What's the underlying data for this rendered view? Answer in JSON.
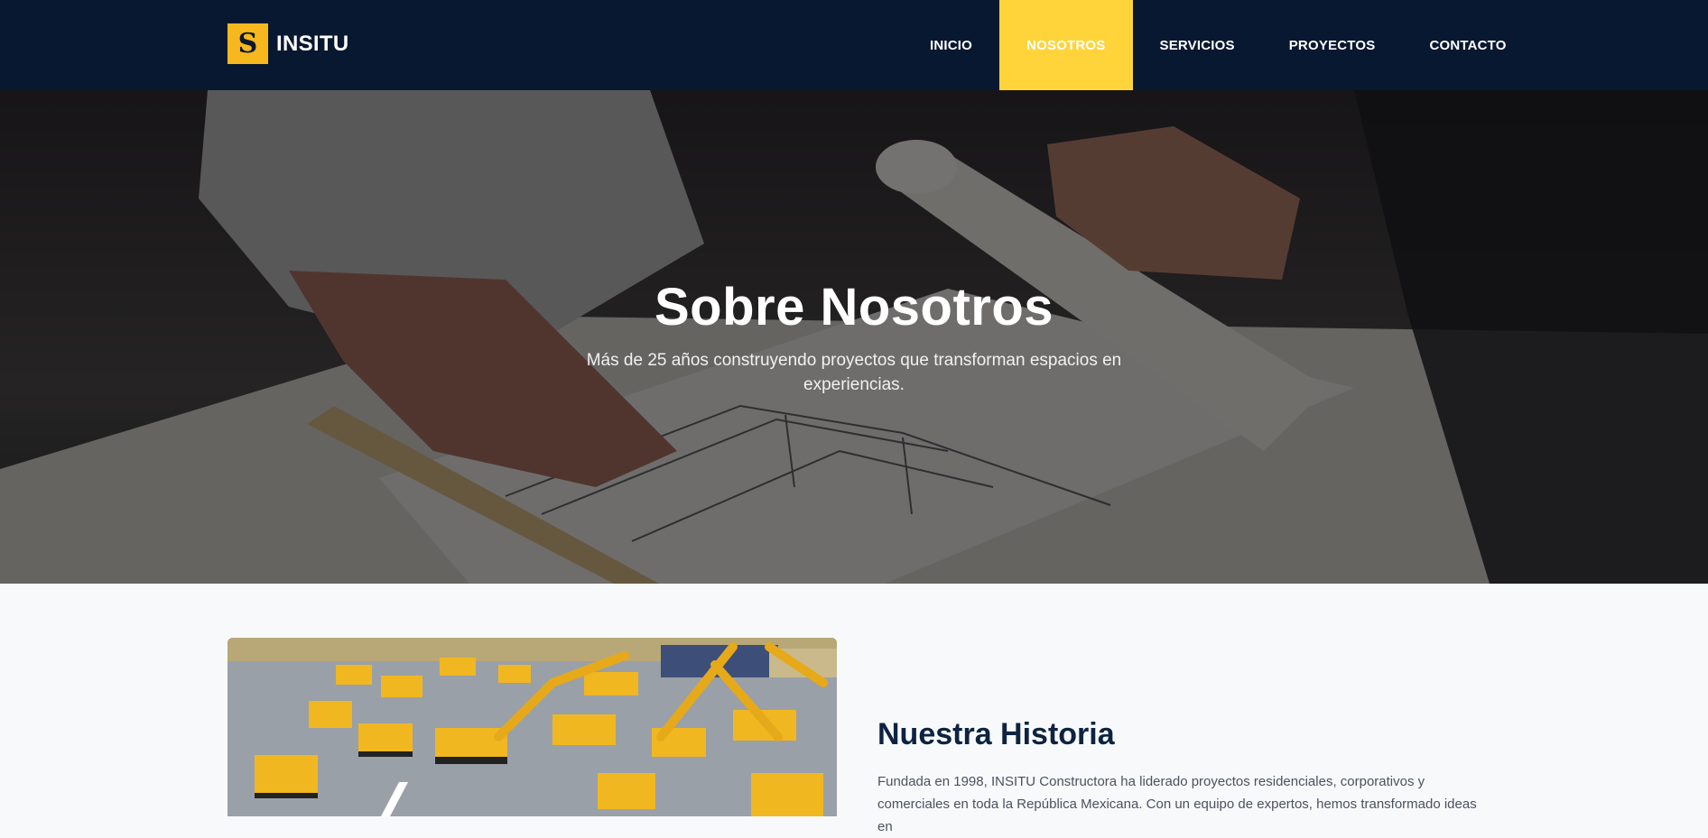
{
  "brand": {
    "logo_letter": "S",
    "name": "INSITU",
    "accent": "#ffd43b",
    "nav_bg": "#081830"
  },
  "nav": {
    "items": [
      {
        "label": "INICIO"
      },
      {
        "label": "NOSOTROS",
        "active": true
      },
      {
        "label": "SERVICIOS"
      },
      {
        "label": "PROYECTOS"
      },
      {
        "label": "CONTACTO"
      }
    ]
  },
  "hero": {
    "title": "Sobre Nosotros",
    "subtitle": "Más de 25 años construyendo proyectos que transforman espacios en experiencias."
  },
  "history": {
    "title": "Nuestra Historia",
    "text": "Fundada en 1998, INSITU Constructora ha liderado proyectos residenciales, corporativos y comerciales en toda la República Mexicana. Con un equipo de expertos, hemos transformado ideas en"
  }
}
